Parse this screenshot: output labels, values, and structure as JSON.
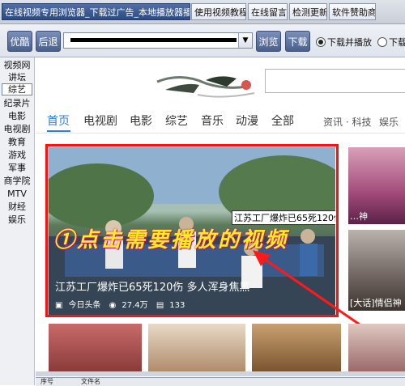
{
  "tabs": [
    {
      "label": "在线视频专用浏览器_下载过广告_本地播放器播放",
      "active": true
    },
    {
      "label": "使用视频教程",
      "active": false
    },
    {
      "label": "在线留言",
      "active": false
    },
    {
      "label": "检测更新",
      "active": false
    },
    {
      "label": "软件赞助商",
      "active": false
    }
  ],
  "toolbar": {
    "btn_youku": "优酷",
    "btn_back": "后退",
    "address_value": "",
    "btn_browse": "浏览",
    "btn_download": "下载",
    "radio_download_play": "下载并播放",
    "radio_download": "下载"
  },
  "sidebar": {
    "items": [
      "视频网",
      "讲坛",
      "综艺",
      "纪录片",
      "电影",
      "电视剧",
      "教育",
      "游戏",
      "军事",
      "商学院",
      "MTV",
      "财经",
      "娱乐"
    ],
    "selected": "综艺"
  },
  "site": {
    "nav": [
      "首页",
      "电视剧",
      "电影",
      "综艺",
      "音乐",
      "动漫",
      "全部"
    ],
    "nav_more1": "资讯 · 科技",
    "nav_more2": "娱乐"
  },
  "feature": {
    "headline_top": "江苏工厂爆炸已65死120伤   多人浑身焦黑",
    "caption": "江苏工厂爆炸已65死120伤    多人浑身焦黑",
    "source": "今日头条",
    "views": "27.4万",
    "comments": "133",
    "annotation": "①点击需要播放的视频"
  },
  "side_captions": {
    "right1": "…神",
    "right2": "[大话]情侣神"
  },
  "status_cols": [
    "序号",
    "文件名"
  ],
  "colors": {
    "accent": "#2f7fd9",
    "highlight_box": "#ff1010",
    "annotation_text": "#ffec1a",
    "active_tab": "#2d4b82"
  },
  "icons": [
    "bird-logo-icon",
    "source-icon",
    "eye-icon",
    "comment-icon",
    "dropdown-arrow-icon",
    "arrow-annotation-icon"
  ]
}
